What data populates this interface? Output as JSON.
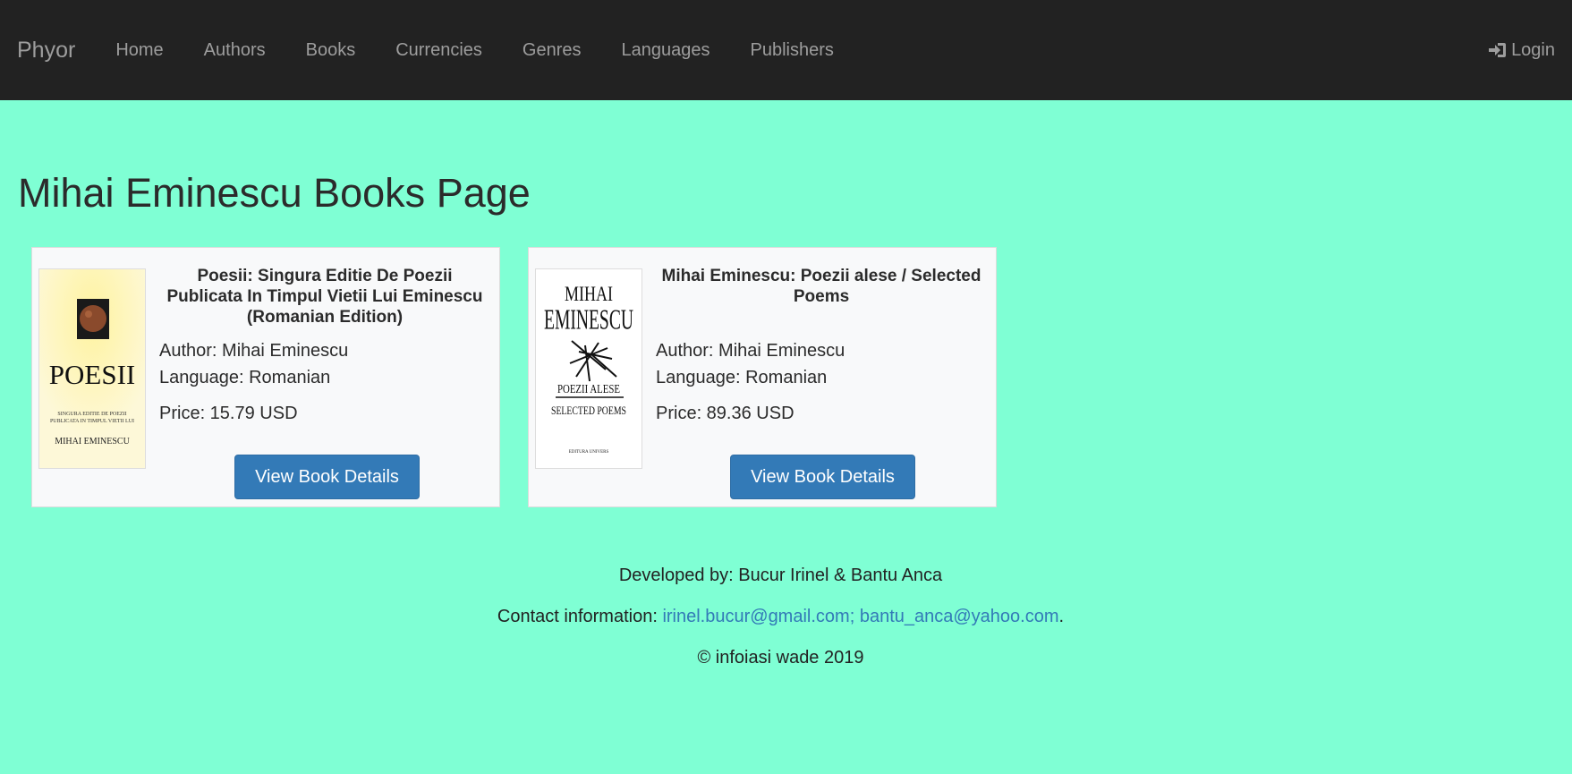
{
  "nav": {
    "brand": "Phyor",
    "links": [
      "Home",
      "Authors",
      "Books",
      "Currencies",
      "Genres",
      "Languages",
      "Publishers"
    ],
    "login": "Login",
    "login_icon": "sign-in-icon"
  },
  "page": {
    "title": "Mihai Eminescu Books Page"
  },
  "books": [
    {
      "title": "Poesii: Singura Editie De Poezii Publicata In Timpul Vietii Lui Eminescu (Romanian Edition)",
      "author": "Author: Mihai Eminescu",
      "language": "Language: Romanian",
      "price": "Price: 15.79 USD",
      "button": "View Book Details",
      "cover": {
        "title": "POESII",
        "subtitle_1": "Singura editie de poezii",
        "subtitle_2": "publicata in timpul vietii lui",
        "author": "Mihai Eminescu",
        "colors": {
          "background": "#fdf8d8",
          "emblem": "#8a4a2c",
          "emblem_frame": "#1a1a1a"
        }
      }
    },
    {
      "title": "Mihai Eminescu: Poezii alese / Selected Poems",
      "author": "Author: Mihai Eminescu",
      "language": "Language: Romanian",
      "price": "Price: 89.36 USD",
      "button": "View Book Details",
      "cover": {
        "line1": "MIHAI",
        "line2": "EMINESCU",
        "line3": "POEZII ALESE",
        "line4": "SELECTED POEMS",
        "publisher": "EDITURA UNIVERS",
        "colors": {
          "background": "#ffffff",
          "ink": "#111111"
        }
      }
    }
  ],
  "footer": {
    "developed": "Developed by: Bucur Irinel & Bantu Anca",
    "contact_label": "Contact information: ",
    "email_1": "irinel.bucur@gmail.com;",
    "email_2": "bantu_anca@yahoo.com",
    "contact_end": ".",
    "copyright": "© infoiasi wade 2019"
  },
  "colors": {
    "page_background": "#7fffd4",
    "navbar": "#222222",
    "nav_text": "#9d9d9d",
    "button": "#337ab7",
    "link": "#337ab7"
  }
}
